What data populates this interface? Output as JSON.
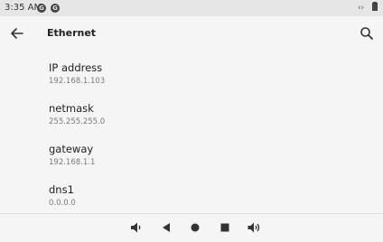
{
  "status_bar": {
    "time": "3:35 AM",
    "app_icons": [
      "G",
      "G"
    ],
    "right_icons": "‹›"
  },
  "app_bar": {
    "back_icon": "arrow-left-icon",
    "title": "Ethernet",
    "search_icon": "search-icon"
  },
  "settings": [
    {
      "label": "IP address",
      "value": "192.168.1.103"
    },
    {
      "label": "netmask",
      "value": "255.255.255.0"
    },
    {
      "label": "gateway",
      "value": "192.168.1.1"
    },
    {
      "label": "dns1",
      "value": "0.0.0.0"
    }
  ],
  "nav_bar": {
    "buttons": [
      "volume-down-icon",
      "back-triangle-icon",
      "home-circle-icon",
      "recents-square-icon",
      "volume-up-icon"
    ]
  }
}
